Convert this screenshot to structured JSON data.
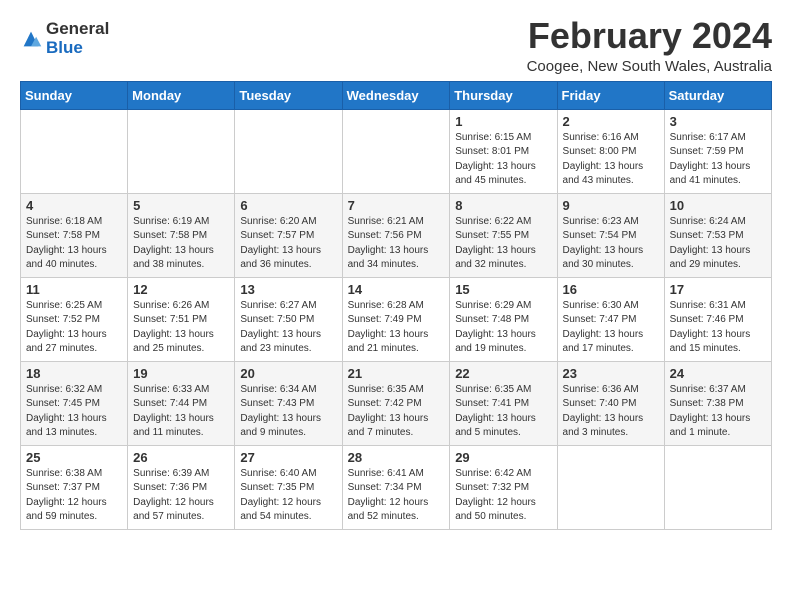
{
  "logo": {
    "general": "General",
    "blue": "Blue"
  },
  "title": "February 2024",
  "subtitle": "Coogee, New South Wales, Australia",
  "days_of_week": [
    "Sunday",
    "Monday",
    "Tuesday",
    "Wednesday",
    "Thursday",
    "Friday",
    "Saturday"
  ],
  "weeks": [
    [
      {
        "day": "",
        "info": ""
      },
      {
        "day": "",
        "info": ""
      },
      {
        "day": "",
        "info": ""
      },
      {
        "day": "",
        "info": ""
      },
      {
        "day": "1",
        "info": "Sunrise: 6:15 AM\nSunset: 8:01 PM\nDaylight: 13 hours\nand 45 minutes."
      },
      {
        "day": "2",
        "info": "Sunrise: 6:16 AM\nSunset: 8:00 PM\nDaylight: 13 hours\nand 43 minutes."
      },
      {
        "day": "3",
        "info": "Sunrise: 6:17 AM\nSunset: 7:59 PM\nDaylight: 13 hours\nand 41 minutes."
      }
    ],
    [
      {
        "day": "4",
        "info": "Sunrise: 6:18 AM\nSunset: 7:58 PM\nDaylight: 13 hours\nand 40 minutes."
      },
      {
        "day": "5",
        "info": "Sunrise: 6:19 AM\nSunset: 7:58 PM\nDaylight: 13 hours\nand 38 minutes."
      },
      {
        "day": "6",
        "info": "Sunrise: 6:20 AM\nSunset: 7:57 PM\nDaylight: 13 hours\nand 36 minutes."
      },
      {
        "day": "7",
        "info": "Sunrise: 6:21 AM\nSunset: 7:56 PM\nDaylight: 13 hours\nand 34 minutes."
      },
      {
        "day": "8",
        "info": "Sunrise: 6:22 AM\nSunset: 7:55 PM\nDaylight: 13 hours\nand 32 minutes."
      },
      {
        "day": "9",
        "info": "Sunrise: 6:23 AM\nSunset: 7:54 PM\nDaylight: 13 hours\nand 30 minutes."
      },
      {
        "day": "10",
        "info": "Sunrise: 6:24 AM\nSunset: 7:53 PM\nDaylight: 13 hours\nand 29 minutes."
      }
    ],
    [
      {
        "day": "11",
        "info": "Sunrise: 6:25 AM\nSunset: 7:52 PM\nDaylight: 13 hours\nand 27 minutes."
      },
      {
        "day": "12",
        "info": "Sunrise: 6:26 AM\nSunset: 7:51 PM\nDaylight: 13 hours\nand 25 minutes."
      },
      {
        "day": "13",
        "info": "Sunrise: 6:27 AM\nSunset: 7:50 PM\nDaylight: 13 hours\nand 23 minutes."
      },
      {
        "day": "14",
        "info": "Sunrise: 6:28 AM\nSunset: 7:49 PM\nDaylight: 13 hours\nand 21 minutes."
      },
      {
        "day": "15",
        "info": "Sunrise: 6:29 AM\nSunset: 7:48 PM\nDaylight: 13 hours\nand 19 minutes."
      },
      {
        "day": "16",
        "info": "Sunrise: 6:30 AM\nSunset: 7:47 PM\nDaylight: 13 hours\nand 17 minutes."
      },
      {
        "day": "17",
        "info": "Sunrise: 6:31 AM\nSunset: 7:46 PM\nDaylight: 13 hours\nand 15 minutes."
      }
    ],
    [
      {
        "day": "18",
        "info": "Sunrise: 6:32 AM\nSunset: 7:45 PM\nDaylight: 13 hours\nand 13 minutes."
      },
      {
        "day": "19",
        "info": "Sunrise: 6:33 AM\nSunset: 7:44 PM\nDaylight: 13 hours\nand 11 minutes."
      },
      {
        "day": "20",
        "info": "Sunrise: 6:34 AM\nSunset: 7:43 PM\nDaylight: 13 hours\nand 9 minutes."
      },
      {
        "day": "21",
        "info": "Sunrise: 6:35 AM\nSunset: 7:42 PM\nDaylight: 13 hours\nand 7 minutes."
      },
      {
        "day": "22",
        "info": "Sunrise: 6:35 AM\nSunset: 7:41 PM\nDaylight: 13 hours\nand 5 minutes."
      },
      {
        "day": "23",
        "info": "Sunrise: 6:36 AM\nSunset: 7:40 PM\nDaylight: 13 hours\nand 3 minutes."
      },
      {
        "day": "24",
        "info": "Sunrise: 6:37 AM\nSunset: 7:38 PM\nDaylight: 13 hours\nand 1 minute."
      }
    ],
    [
      {
        "day": "25",
        "info": "Sunrise: 6:38 AM\nSunset: 7:37 PM\nDaylight: 12 hours\nand 59 minutes."
      },
      {
        "day": "26",
        "info": "Sunrise: 6:39 AM\nSunset: 7:36 PM\nDaylight: 12 hours\nand 57 minutes."
      },
      {
        "day": "27",
        "info": "Sunrise: 6:40 AM\nSunset: 7:35 PM\nDaylight: 12 hours\nand 54 minutes."
      },
      {
        "day": "28",
        "info": "Sunrise: 6:41 AM\nSunset: 7:34 PM\nDaylight: 12 hours\nand 52 minutes."
      },
      {
        "day": "29",
        "info": "Sunrise: 6:42 AM\nSunset: 7:32 PM\nDaylight: 12 hours\nand 50 minutes."
      },
      {
        "day": "",
        "info": ""
      },
      {
        "day": "",
        "info": ""
      }
    ]
  ]
}
